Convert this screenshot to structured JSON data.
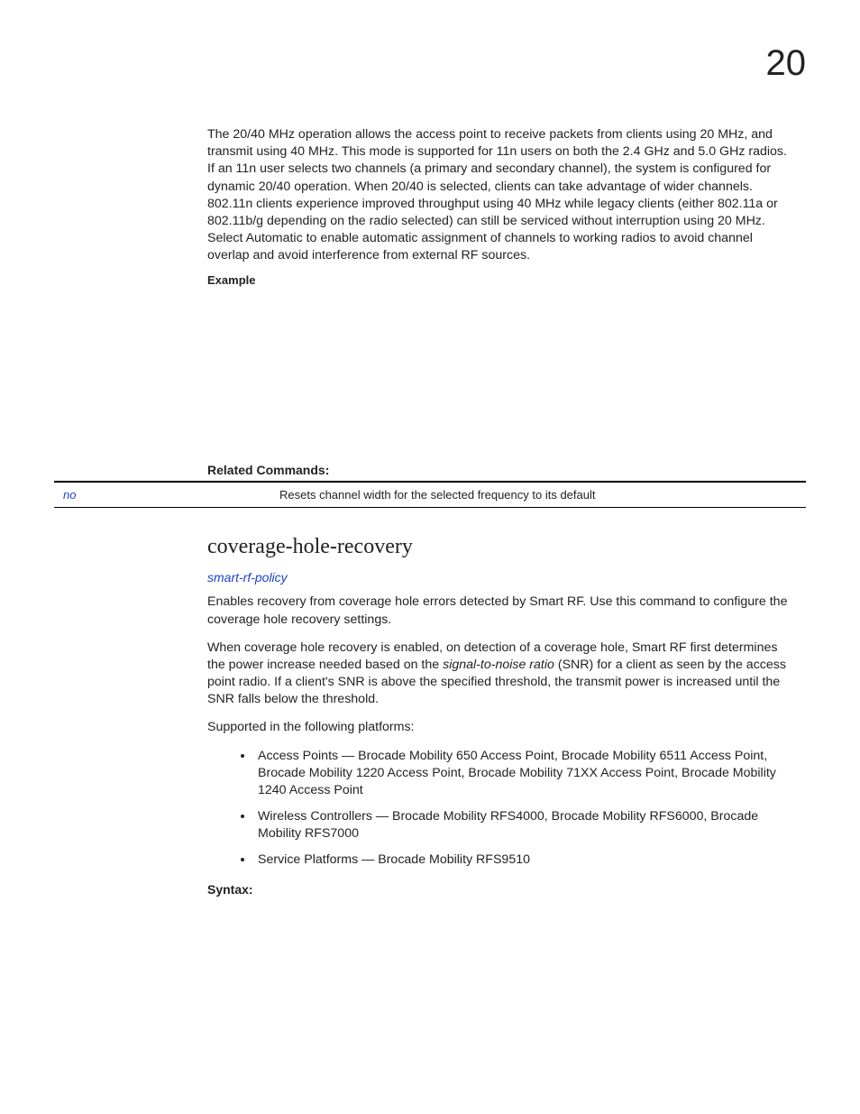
{
  "chapter_number": "20",
  "intro_paragraph": "The 20/40 MHz operation allows the access point to receive packets from clients using 20 MHz, and transmit using 40 MHz. This mode is supported for 11n users on both the 2.4 GHz and 5.0 GHz radios. If an 11n user selects two channels (a primary and secondary channel), the system is configured for dynamic 20/40 operation. When 20/40 is selected, clients can take advantage of wider channels. 802.11n clients experience improved throughput using 40 MHz while legacy clients (either 802.11a or 802.11b/g depending on the radio selected) can still be serviced without interruption using 20 MHz. Select Automatic to enable automatic assignment of channels to working radios to avoid channel overlap and avoid interference from external RF sources.",
  "example_label": "Example",
  "related_commands_label": "Related Commands:",
  "related_row": {
    "cmd": "no",
    "desc": "Resets channel width for the selected frequency to its default"
  },
  "section_heading": "coverage-hole-recovery",
  "section_link": "smart-rf-policy",
  "section_p1": "Enables recovery from coverage hole errors detected by Smart RF. Use this command to configure the coverage hole recovery settings.",
  "section_p2_pre": "When coverage hole recovery is enabled, on detection of a coverage hole, Smart RF first determines the power increase needed based on the ",
  "section_p2_ital": "signal-to-noise ratio",
  "section_p2_post": " (SNR) for a client as seen by the access point radio. If a client's SNR is above the specified threshold, the transmit power is increased until the SNR falls below the threshold.",
  "supported_label": "Supported in the following platforms:",
  "platforms": [
    "Access Points — Brocade Mobility 650 Access Point, Brocade Mobility 6511 Access Point, Brocade Mobility 1220 Access Point, Brocade Mobility 71XX Access Point, Brocade Mobility 1240 Access Point",
    "Wireless Controllers — Brocade Mobility RFS4000, Brocade Mobility RFS6000, Brocade Mobility RFS7000",
    "Service Platforms — Brocade Mobility RFS9510"
  ],
  "syntax_label": "Syntax:"
}
